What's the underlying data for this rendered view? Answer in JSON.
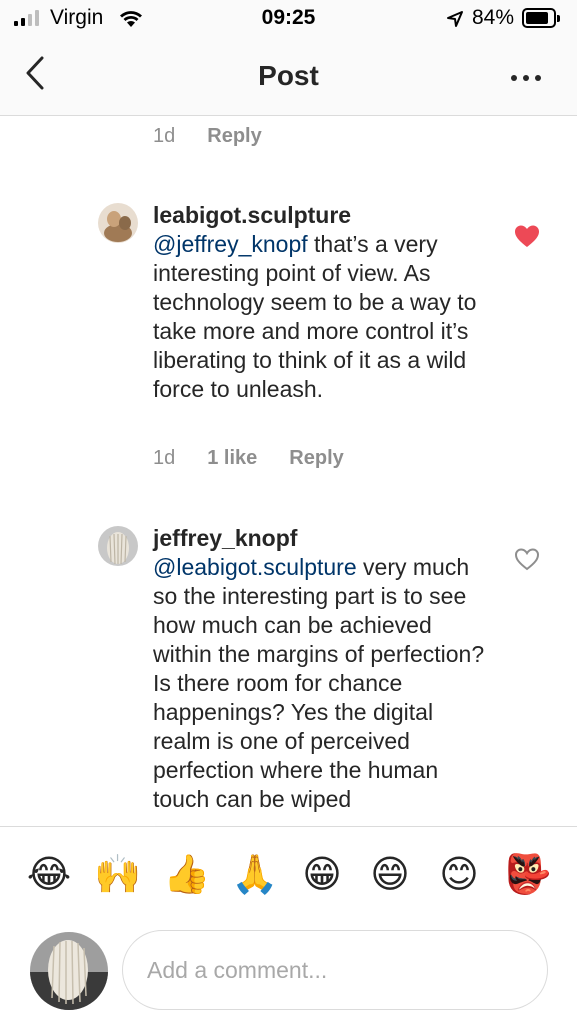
{
  "status_bar": {
    "carrier": "Virgin",
    "time": "09:25",
    "battery_percent": "84%",
    "battery_level": 0.84
  },
  "nav": {
    "title": "Post",
    "back_icon": "chevron-left-icon",
    "more_icon": "more-horizontal-icon"
  },
  "previous_comment_meta": {
    "time": "1d",
    "reply": "Reply"
  },
  "comments": [
    {
      "username": "leabigot.sculpture",
      "mention": "@jeffrey_knopf",
      "text": " that’s a very interesting point of view. As technology seem to be a way to take more and more control it’s liberating to think of it as a wild force to unleash.",
      "time": "1d",
      "likes": "1 like",
      "reply": "Reply",
      "liked": true
    },
    {
      "username": "jeffrey_knopf",
      "mention": "@leabigot.sculpture",
      "text": " very much so the interesting part is to see how much can be achieved within the margins of perfection? Is there room for chance happenings? Yes the digital realm is one of perceived perfection where the human touch can be wiped",
      "liked": false
    }
  ],
  "emoji_bar": [
    "😂",
    "🙌",
    "👍",
    "🙏",
    "😁",
    "😄",
    "😊",
    "👺"
  ],
  "composer": {
    "placeholder": "Add a comment..."
  },
  "colors": {
    "mention": "#003569",
    "heart": "#ed4956",
    "secondary_text": "#8e8e8e"
  }
}
